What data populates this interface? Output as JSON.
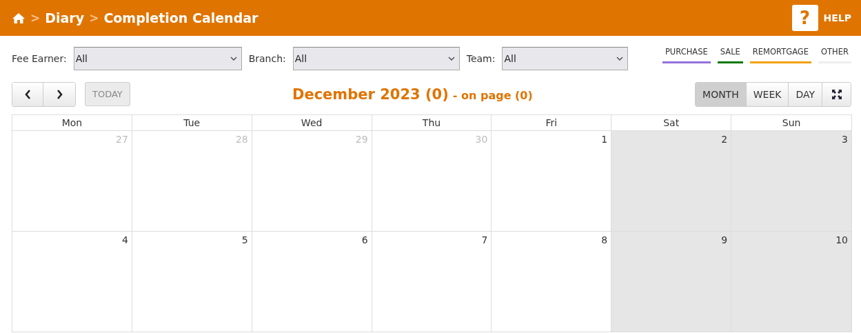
{
  "breadcrumb": [
    "Diary",
    "Completion Calendar"
  ],
  "breadcrumb_separator": ">",
  "help": {
    "icon": "?",
    "label": "HELP"
  },
  "filters": [
    {
      "label": "Fee Earner:",
      "value": "All"
    },
    {
      "label": "Branch:",
      "value": "All"
    },
    {
      "label": "Team:",
      "value": "All"
    }
  ],
  "legend": [
    {
      "label": "PURCHASE",
      "color": "#9370db"
    },
    {
      "label": "SALE",
      "color": "#087808"
    },
    {
      "label": "REMORTGAGE",
      "color": "#f5a10a"
    },
    {
      "label": "OTHER",
      "color": "#eeeeee"
    }
  ],
  "today_button": {
    "label": "TODAY",
    "disabled": true
  },
  "title": {
    "main": "December 2023 (0)",
    "sub": "- on page (0)"
  },
  "views": [
    {
      "label": "MONTH",
      "selected": true
    },
    {
      "label": "WEEK",
      "selected": false
    },
    {
      "label": "DAY",
      "selected": false
    }
  ],
  "weekdays": [
    "Mon",
    "Tue",
    "Wed",
    "Thu",
    "Fri",
    "Sat",
    "Sun"
  ],
  "weeks": [
    [
      {
        "day": "27",
        "other_month": true,
        "weekend": false
      },
      {
        "day": "28",
        "other_month": true,
        "weekend": false
      },
      {
        "day": "29",
        "other_month": true,
        "weekend": false
      },
      {
        "day": "30",
        "other_month": true,
        "weekend": false
      },
      {
        "day": "1",
        "other_month": false,
        "weekend": false
      },
      {
        "day": "2",
        "other_month": false,
        "weekend": true
      },
      {
        "day": "3",
        "other_month": false,
        "weekend": true
      }
    ],
    [
      {
        "day": "4",
        "other_month": false,
        "weekend": false
      },
      {
        "day": "5",
        "other_month": false,
        "weekend": false
      },
      {
        "day": "6",
        "other_month": false,
        "weekend": false
      },
      {
        "day": "7",
        "other_month": false,
        "weekend": false
      },
      {
        "day": "8",
        "other_month": false,
        "weekend": false
      },
      {
        "day": "9",
        "other_month": false,
        "weekend": true
      },
      {
        "day": "10",
        "other_month": false,
        "weekend": true
      }
    ]
  ]
}
